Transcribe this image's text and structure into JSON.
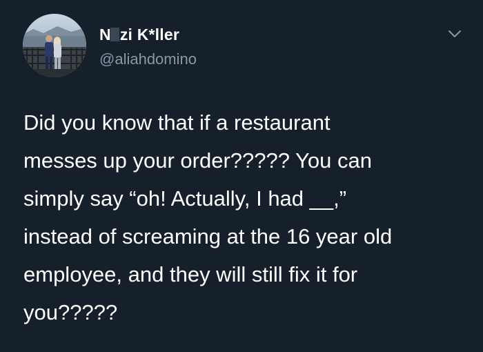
{
  "tweet": {
    "author": {
      "name_prefix": "N",
      "name_suffix": "zi K*ller",
      "handle": "@aliahdomino"
    },
    "body_lines": [
      "Did you know that if a restaurant",
      "messes up your order????? You can",
      "simply say “oh! Actually, I had __,”",
      "instead of screaming at the 16 year old",
      "employee, and they will still fix it for",
      "you?????"
    ],
    "icons": {
      "avatar": "profile-photo",
      "menu": "chevron-down-icon"
    }
  },
  "colors": {
    "background": "#15202b",
    "text": "#ffffff",
    "secondary_text": "#8899a6",
    "censor_block": "#3a4654"
  }
}
